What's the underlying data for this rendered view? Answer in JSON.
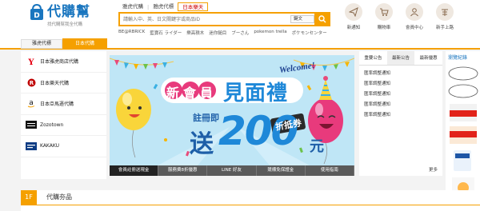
{
  "brand": {
    "name": "代購幫",
    "tagline": "找代購幫我全代購"
  },
  "site_tabs": [
    "雅虎代購",
    "雅虎代標",
    "日本樂天"
  ],
  "search": {
    "placeholder": "請輸入中、英、日文關鍵字或商品ID",
    "select_value": "鍵文"
  },
  "hot_keywords": [
    "BE@RBRICK",
    "藍寶石 ライダー",
    "樂高積木",
    "迷你鎚目",
    "ブーさん",
    "pokemon trella",
    "ポケモンセンター"
  ],
  "icon_nav": [
    {
      "label": "新通知",
      "icon": "paper-plane-icon"
    },
    {
      "label": "購物車",
      "icon": "cart-icon"
    },
    {
      "label": "會員中心",
      "icon": "user-icon"
    },
    {
      "label": "新手上路",
      "icon": "guide-icon"
    }
  ],
  "category_tabs": {
    "a": "雅虎代標",
    "b": "日本代購"
  },
  "shops": [
    {
      "label": "日本雅虎商店代購",
      "icon": "yahoo-logo-icon"
    },
    {
      "label": "日本樂天代購",
      "icon": "rakuten-logo-icon"
    },
    {
      "label": "日本亞馬遜代購",
      "icon": "amazon-logo-icon"
    },
    {
      "label": "Zozotown",
      "icon": "zozotown-logo-icon"
    },
    {
      "label": "KAKAKU",
      "icon": "kakaku-logo-icon"
    }
  ],
  "banner": {
    "welcome": "Welcome!",
    "title_left": "新會員",
    "title_right": "見面禮",
    "register": "註冊即",
    "send": "送",
    "amount": "200",
    "unit": "元",
    "coupon": "折抵券"
  },
  "banner_nav": [
    "會員註冊送現金",
    "服務費8折優惠",
    "LINE 好友",
    "競標免保證金",
    "使用指南"
  ],
  "news": {
    "tabs": [
      "重要公告",
      "最新公告",
      "最新優惠"
    ],
    "items": [
      "匯率調整通知",
      "匯率調整通知",
      "匯率調整通知",
      "匯率調整通知",
      "匯率調整通知"
    ],
    "more": "更多"
  },
  "recent": {
    "title": "瀏覽紀錄"
  },
  "floor": {
    "number": "1F",
    "name": "代購夯品"
  },
  "colors": {
    "accent": "#f5a000",
    "brand": "#1a76bf",
    "banner_blue": "#1e88d8",
    "pink": "#e83a7c"
  }
}
